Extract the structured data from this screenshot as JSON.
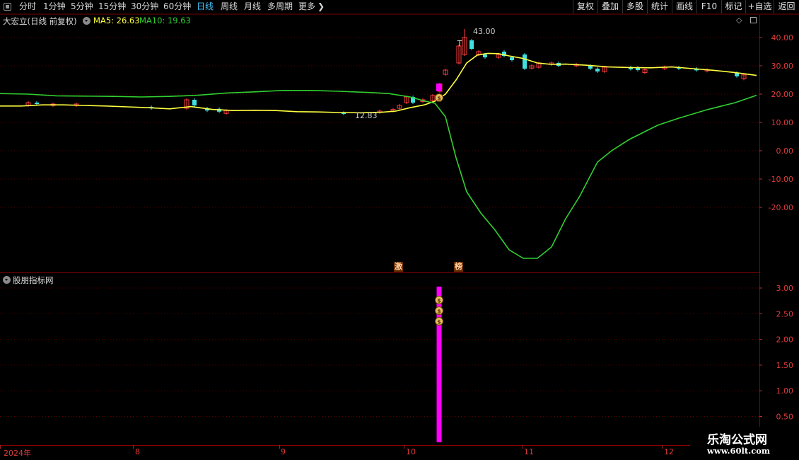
{
  "toolbar": {
    "periods": [
      "分时",
      "1分钟",
      "5分钟",
      "15分钟",
      "30分钟",
      "60分钟",
      "日线",
      "周线",
      "月线",
      "多周期",
      "更多"
    ],
    "active_period": "日线",
    "actions": [
      "复权",
      "叠加",
      "多股",
      "统计",
      "画线",
      "F10",
      "标记",
      "+自选",
      "返回"
    ]
  },
  "main_panel": {
    "title": "大宏立(日线 前复权)",
    "ma5_label": "MA5: 26.63",
    "ma10_label": "MA10: 19.63",
    "high_annotation": "43.00",
    "low_annotation": "12.83",
    "tag_1": "激",
    "tag_2": "榜",
    "colors": {
      "ma5": "#ffff40",
      "ma10": "#30d030",
      "up": "#ff3c3c",
      "down": "#40e0e0",
      "grid": "#5a0000"
    }
  },
  "sub_panel": {
    "title": "股朋指标网",
    "bar_color": "#ff00ff"
  },
  "date_axis": [
    "2024年",
    "8",
    "9",
    "10",
    "11",
    "12"
  ],
  "watermark": {
    "cn": "乐淘公式网",
    "url": "www.60lt.com"
  },
  "chart_data": [
    {
      "type": "candlestick",
      "title": "大宏立(日线 前复权)",
      "yticks": [
        40,
        30,
        20,
        10,
        0,
        -10,
        -20
      ],
      "ylim": [
        -28,
        44
      ],
      "series": [
        {
          "name": "MA5",
          "value_last": 26.63,
          "x": [
            0,
            30,
            60,
            90,
            120,
            150,
            180,
            210,
            240,
            270,
            300,
            330,
            360,
            390,
            420,
            450,
            480,
            510,
            540,
            560,
            580,
            600,
            615,
            630,
            645,
            660,
            675,
            690,
            705,
            720,
            740,
            760,
            780,
            800,
            830,
            860,
            890,
            920,
            950,
            980,
            1010,
            1040,
            1070
          ],
          "values": [
            15.8,
            15.8,
            16.2,
            16.2,
            16.0,
            15.8,
            15.5,
            15.2,
            14.8,
            15.6,
            14.6,
            14.2,
            14.3,
            14.2,
            13.8,
            13.7,
            13.5,
            13.4,
            13.6,
            14.0,
            15.2,
            16.2,
            17.5,
            20.0,
            25.0,
            31.0,
            33.8,
            34.4,
            34.3,
            33.5,
            32.6,
            31.0,
            30.5,
            30.6,
            30.2,
            29.6,
            29.4,
            29.3,
            29.6,
            29.0,
            28.4,
            27.6,
            26.6
          ]
        },
        {
          "name": "MA10",
          "value_last": 19.63,
          "x": [
            0,
            40,
            80,
            120,
            160,
            200,
            240,
            280,
            320,
            360,
            400,
            440,
            480,
            520,
            550,
            580,
            600,
            615,
            630,
            645,
            660,
            680,
            700,
            720,
            740,
            760,
            780,
            800,
            820,
            845,
            865,
            890,
            930,
            960,
            1000,
            1040,
            1070
          ],
          "values": [
            20.2,
            20.0,
            19.4,
            19.3,
            19.2,
            19.0,
            19.2,
            19.6,
            20.4,
            20.8,
            21.3,
            21.3,
            21.0,
            20.6,
            20.2,
            19.0,
            17.6,
            16.8,
            12.0,
            -2.5,
            -14.5,
            -22.0,
            -28.0,
            -35.0,
            -38.0,
            -38.0,
            -34.0,
            -24.0,
            -16.0,
            -4.0,
            0.0,
            4.0,
            9.0,
            11.5,
            14.5,
            17.0,
            19.6
          ]
        }
      ],
      "annotations": [
        "43.00",
        "12.83"
      ]
    },
    {
      "type": "bar",
      "title": "股朋指标网",
      "yticks": [
        3.0,
        2.5,
        2.0,
        1.5,
        1.0,
        0.5
      ],
      "ylim": [
        0.3,
        3.2
      ],
      "x": [
        621
      ],
      "values": [
        3.0
      ]
    }
  ]
}
